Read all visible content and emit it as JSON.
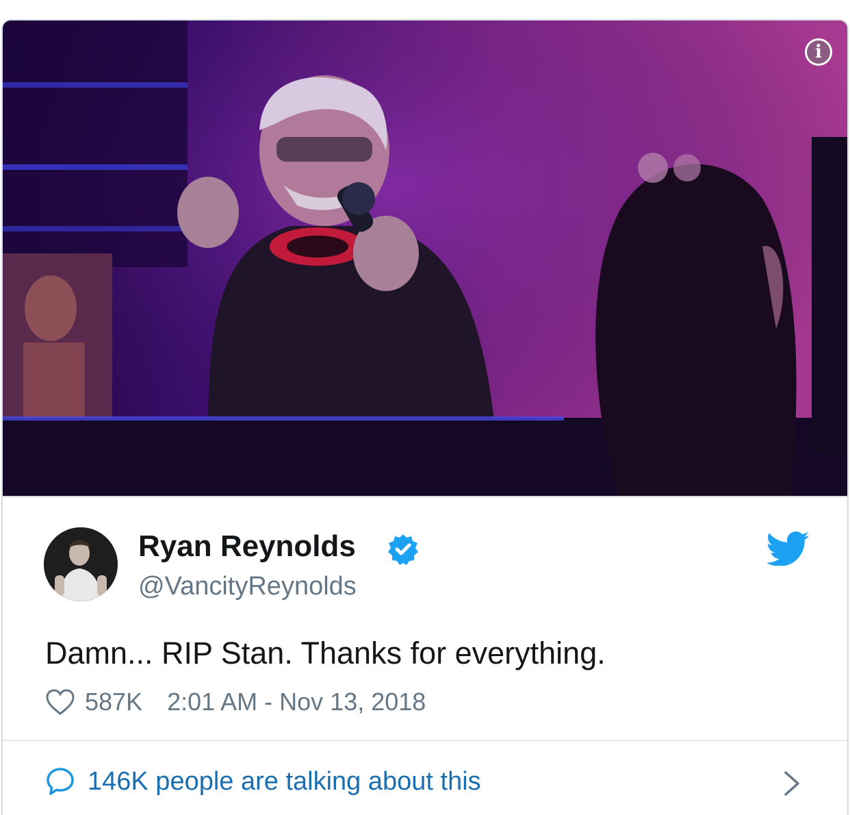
{
  "tweet": {
    "author_name": "Ryan Reynolds",
    "handle": "@VancityReynolds",
    "text": "Damn... RIP Stan. Thanks for everything.",
    "likes": "587K",
    "timestamp": "2:01 AM - Nov 13, 2018",
    "talking": "146K people are talking about this",
    "verified": true
  },
  "media": {
    "info_label": "i",
    "description_icon": "info-icon"
  },
  "icons": {
    "brand": "twitter-bird-icon",
    "like": "heart-icon",
    "reply": "speech-bubble-icon",
    "more": "chevron-right-icon"
  },
  "colors": {
    "text": "#14171a",
    "secondary": "#657786",
    "link": "#1b6fb0",
    "verified": "#1da1f2",
    "brand": "#1da1f2"
  }
}
